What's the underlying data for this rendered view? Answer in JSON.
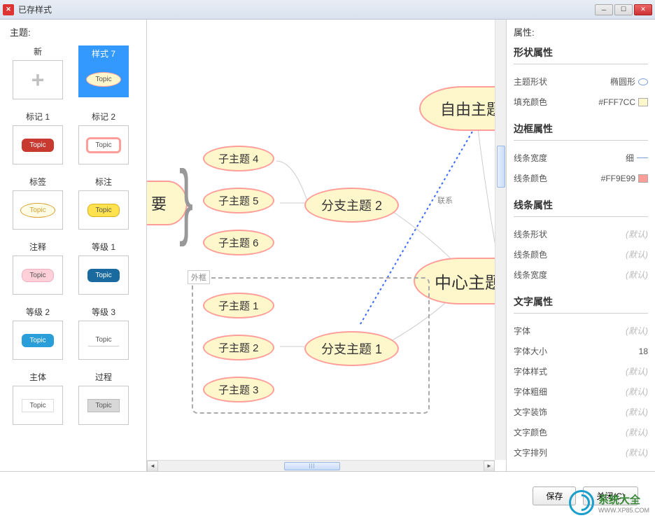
{
  "window": {
    "title": "已存样式"
  },
  "left": {
    "title": "主题:",
    "items": [
      {
        "label": "新",
        "kind": "new"
      },
      {
        "label": "样式 7",
        "kind": "oval",
        "fill": "#fff7cc",
        "border": "#ff9e99",
        "text": "Topic",
        "selected": true
      },
      {
        "label": "标记 1",
        "kind": "rounded",
        "fill": "#c8392f",
        "border": "#c8392f",
        "text": "Topic",
        "textcolor": "#fff"
      },
      {
        "label": "标记 2",
        "kind": "rounded",
        "fill": "#fff",
        "border": "#ff9e99",
        "text": "Topic",
        "borderw": 3
      },
      {
        "label": "标签",
        "kind": "oval",
        "fill": "#fffde6",
        "border": "#d8a030",
        "text": "Topic",
        "textcolor": "#d8a030"
      },
      {
        "label": "标注",
        "kind": "callout",
        "fill": "#ffe24d",
        "border": "#d8b020",
        "text": "Topic"
      },
      {
        "label": "注释",
        "kind": "callout",
        "fill": "#ffd0d8",
        "border": "#eeb0c0",
        "text": "Topic"
      },
      {
        "label": "等级 1",
        "kind": "rounded",
        "fill": "#1a6aa0",
        "border": "#1a6aa0",
        "text": "Topic",
        "textcolor": "#fff"
      },
      {
        "label": "等级 2",
        "kind": "rounded",
        "fill": "#2a9ed8",
        "border": "#2a9ed8",
        "text": "Topic",
        "textcolor": "#fff"
      },
      {
        "label": "等级 3",
        "kind": "underline",
        "fill": "#fff",
        "border": "#ccc",
        "text": "Topic"
      },
      {
        "label": "主体",
        "kind": "rect",
        "fill": "#fff",
        "border": "#ddd",
        "text": "Topic"
      },
      {
        "label": "过程",
        "kind": "rect",
        "fill": "#d8d8d8",
        "border": "#bbb",
        "text": "Topic"
      }
    ]
  },
  "canvas": {
    "main_partial": "要",
    "subtopics_a": [
      "子主题 4",
      "子主题 5",
      "子主题 6"
    ],
    "branch_a": "分支主题 2",
    "relation_label": "联系",
    "boundary_label": "外框",
    "subtopics_b": [
      "子主题 1",
      "子主题 2",
      "子主题 3"
    ],
    "branch_b": "分支主题 1",
    "free_topic": "自由主题",
    "central": "中心主题"
  },
  "right": {
    "title": "属性:",
    "sections": [
      {
        "title": "形状属性",
        "rows": [
          {
            "name": "主题形状",
            "value": "椭圆形",
            "icon": "shape"
          },
          {
            "name": "填充颜色",
            "value": "#FFF7CC",
            "swatch": "#FFF7CC"
          }
        ]
      },
      {
        "title": "边框属性",
        "rows": [
          {
            "name": "线条宽度",
            "value": "细",
            "icon": "line"
          },
          {
            "name": "线条颜色",
            "value": "#FF9E99",
            "swatch": "#FF9E99"
          }
        ]
      },
      {
        "title": "线条属性",
        "rows": [
          {
            "name": "线条形状",
            "value": "(默认)",
            "default": true
          },
          {
            "name": "线条颜色",
            "value": "(默认)",
            "default": true
          },
          {
            "name": "线条宽度",
            "value": "(默认)",
            "default": true
          }
        ]
      },
      {
        "title": "文字属性",
        "rows": [
          {
            "name": "字体",
            "value": "(默认)",
            "default": true
          },
          {
            "name": "字体大小",
            "value": "18"
          },
          {
            "name": "字体样式",
            "value": "(默认)",
            "default": true
          },
          {
            "name": "字体粗细",
            "value": "(默认)",
            "default": true
          },
          {
            "name": "文字装饰",
            "value": "(默认)",
            "default": true
          },
          {
            "name": "文字颜色",
            "value": "(默认)",
            "default": true
          },
          {
            "name": "文字排列",
            "value": "(默认)",
            "default": true
          }
        ]
      }
    ]
  },
  "buttons": {
    "save": "保存",
    "close": "关闭(C)"
  },
  "watermark": {
    "name": "系统大全",
    "url": "WWW.XP85.COM"
  }
}
